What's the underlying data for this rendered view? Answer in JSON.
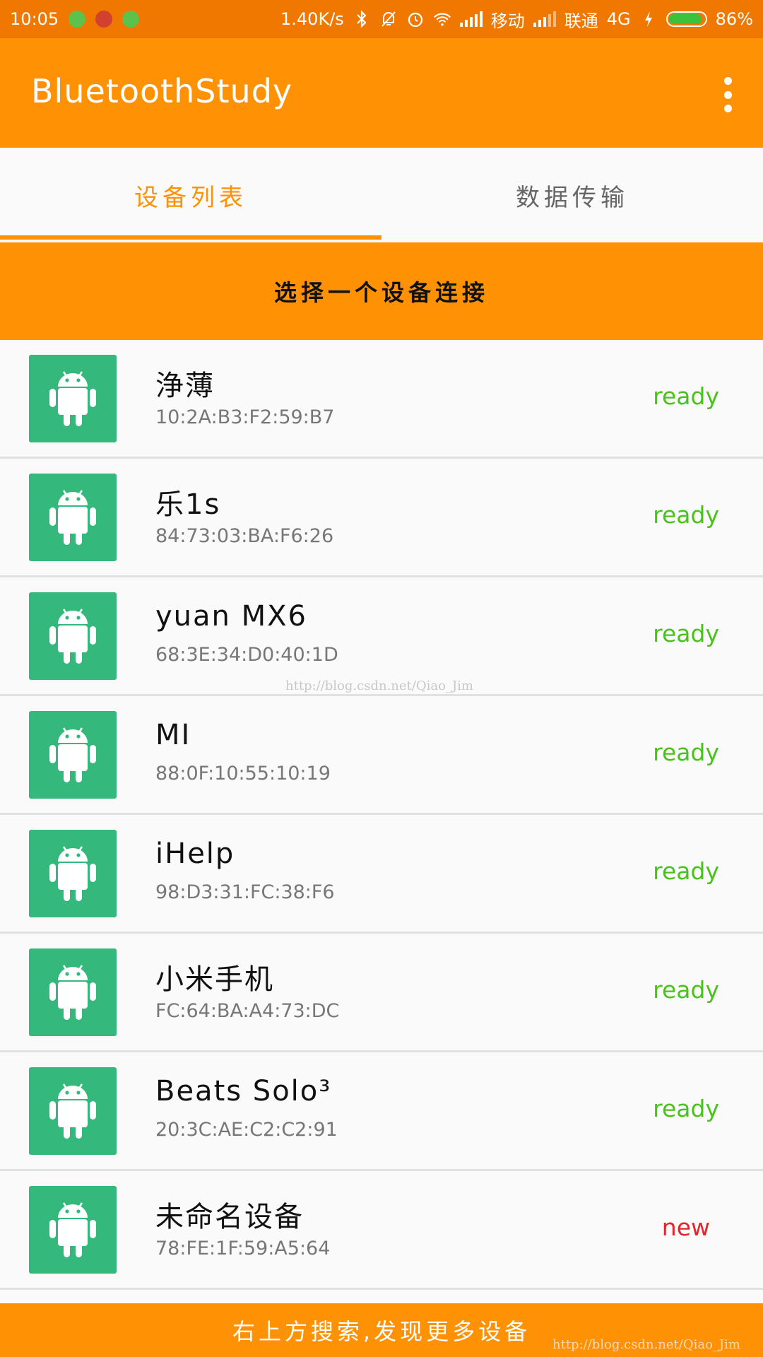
{
  "status_bar": {
    "time": "10:05",
    "net_speed": "1.40K/s",
    "carrier1": "移动",
    "carrier2": "联通",
    "network_type": "4G",
    "battery": "86%",
    "icons": [
      "sim-icon",
      "app-icon",
      "android-icon",
      "bluetooth-icon",
      "mute-icon",
      "alarm-icon",
      "wifi-icon",
      "signal-icon",
      "charging-icon",
      "battery-icon"
    ]
  },
  "app_bar": {
    "title": "BluetoothStudy",
    "menu_icon": "more-vert-icon"
  },
  "tabs": [
    {
      "label": "设备列表",
      "active": true
    },
    {
      "label": "数据传输",
      "active": false
    }
  ],
  "banner": {
    "text": "选择一个设备连接"
  },
  "devices": [
    {
      "name": "浄薄",
      "mac": "10:2A:B3:F2:59:B7",
      "status": "ready"
    },
    {
      "name": "乐1s",
      "mac": "84:73:03:BA:F6:26",
      "status": "ready"
    },
    {
      "name": "yuan MX6",
      "mac": "68:3E:34:D0:40:1D",
      "status": "ready"
    },
    {
      "name": "MI",
      "mac": "88:0F:10:55:10:19",
      "status": "ready"
    },
    {
      "name": "iHelp",
      "mac": "98:D3:31:FC:38:F6",
      "status": "ready"
    },
    {
      "name": "小米手机",
      "mac": "FC:64:BA:A4:73:DC",
      "status": "ready"
    },
    {
      "name": "Beats Solo³",
      "mac": "20:3C:AE:C2:C2:91",
      "status": "ready"
    },
    {
      "name": "未命名设备",
      "mac": "78:FE:1F:59:A5:64",
      "status": "new"
    }
  ],
  "footer": {
    "text": "右上方搜索,发现更多设备"
  },
  "watermarks": {
    "center": "http://blog.csdn.net/Qiao_Jim",
    "corner": "http://blog.csdn.net/Qiao_Jim"
  },
  "colors": {
    "accent": "#ff9204",
    "status_bar": "#f07800",
    "avatar_bg": "#35b87c",
    "ready": "#49c21c",
    "new": "#e0262b"
  }
}
